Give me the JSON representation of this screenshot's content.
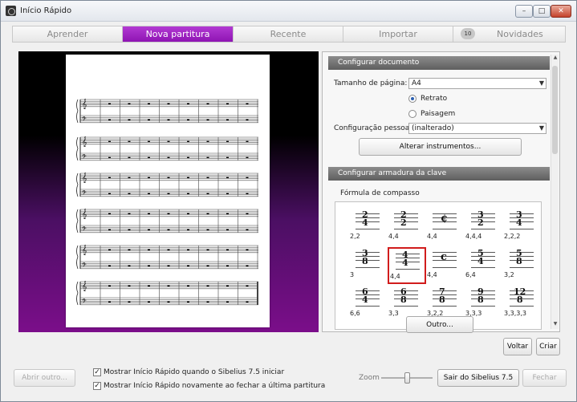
{
  "window": {
    "title": "Início Rápido",
    "min_label": "–",
    "max_label": "□",
    "close_label": "✕"
  },
  "tabs": [
    {
      "label": "Aprender"
    },
    {
      "label": "Nova partitura"
    },
    {
      "label": "Recente"
    },
    {
      "label": "Importar"
    },
    {
      "label": "Novidades",
      "badge": "10"
    }
  ],
  "active_tab": "Nova partitura",
  "document": {
    "header": "Configurar documento",
    "page_size_label": "Tamanho de página:",
    "page_size_value": "A4",
    "orientation_options": [
      "Retrato",
      "Paisagem"
    ],
    "orientation_selected": "Retrato",
    "house_style_label": "Configuração pessoal",
    "house_style_value": "(inalterado)",
    "change_instruments_label": "Alterar instrumentos..."
  },
  "key_signature": {
    "header": "Configurar armadura da clave",
    "time_sig_label": "Fórmula de compasso",
    "time_signatures": [
      {
        "top": "2",
        "bottom": "4",
        "beaming": "2,2"
      },
      {
        "top": "2",
        "bottom": "2",
        "beaming": "4,4"
      },
      {
        "symbol": "¢",
        "beaming": "4,4"
      },
      {
        "top": "3",
        "bottom": "2",
        "beaming": "4,4,4"
      },
      {
        "top": "3",
        "bottom": "4",
        "beaming": "2,2,2"
      },
      {
        "top": "3",
        "bottom": "8",
        "beaming": "3"
      },
      {
        "top": "4",
        "bottom": "4",
        "beaming": "4,4",
        "selected": true
      },
      {
        "symbol": "c",
        "beaming": "4,4"
      },
      {
        "top": "5",
        "bottom": "4",
        "beaming": "6,4"
      },
      {
        "top": "5",
        "bottom": "8",
        "beaming": "3,2"
      },
      {
        "top": "6",
        "bottom": "4",
        "beaming": "6,6"
      },
      {
        "top": "6",
        "bottom": "8",
        "beaming": "3,3"
      },
      {
        "top": "7",
        "bottom": "8",
        "beaming": "3,2,2"
      },
      {
        "top": "9",
        "bottom": "8",
        "beaming": "3,3,3"
      },
      {
        "top": "12",
        "bottom": "8",
        "beaming": "3,3,3,3"
      }
    ],
    "other_label": "Outro..."
  },
  "buttons": {
    "back": "Voltar",
    "create": "Criar",
    "open_other": "Abrir outro...",
    "exit": "Sair do Sibelius 7.5",
    "close": "Fechar"
  },
  "footer": {
    "show_on_start": "Mostrar Início Rápido quando o Sibelius 7.5 iniciar",
    "show_after_close": "Mostrar Início Rápido novamente ao fechar a última partitura",
    "zoom_label": "Zoom",
    "zoom_level": 0.5
  },
  "colors": {
    "accent": "#9c1fc2",
    "selection": "#d11c1c"
  }
}
